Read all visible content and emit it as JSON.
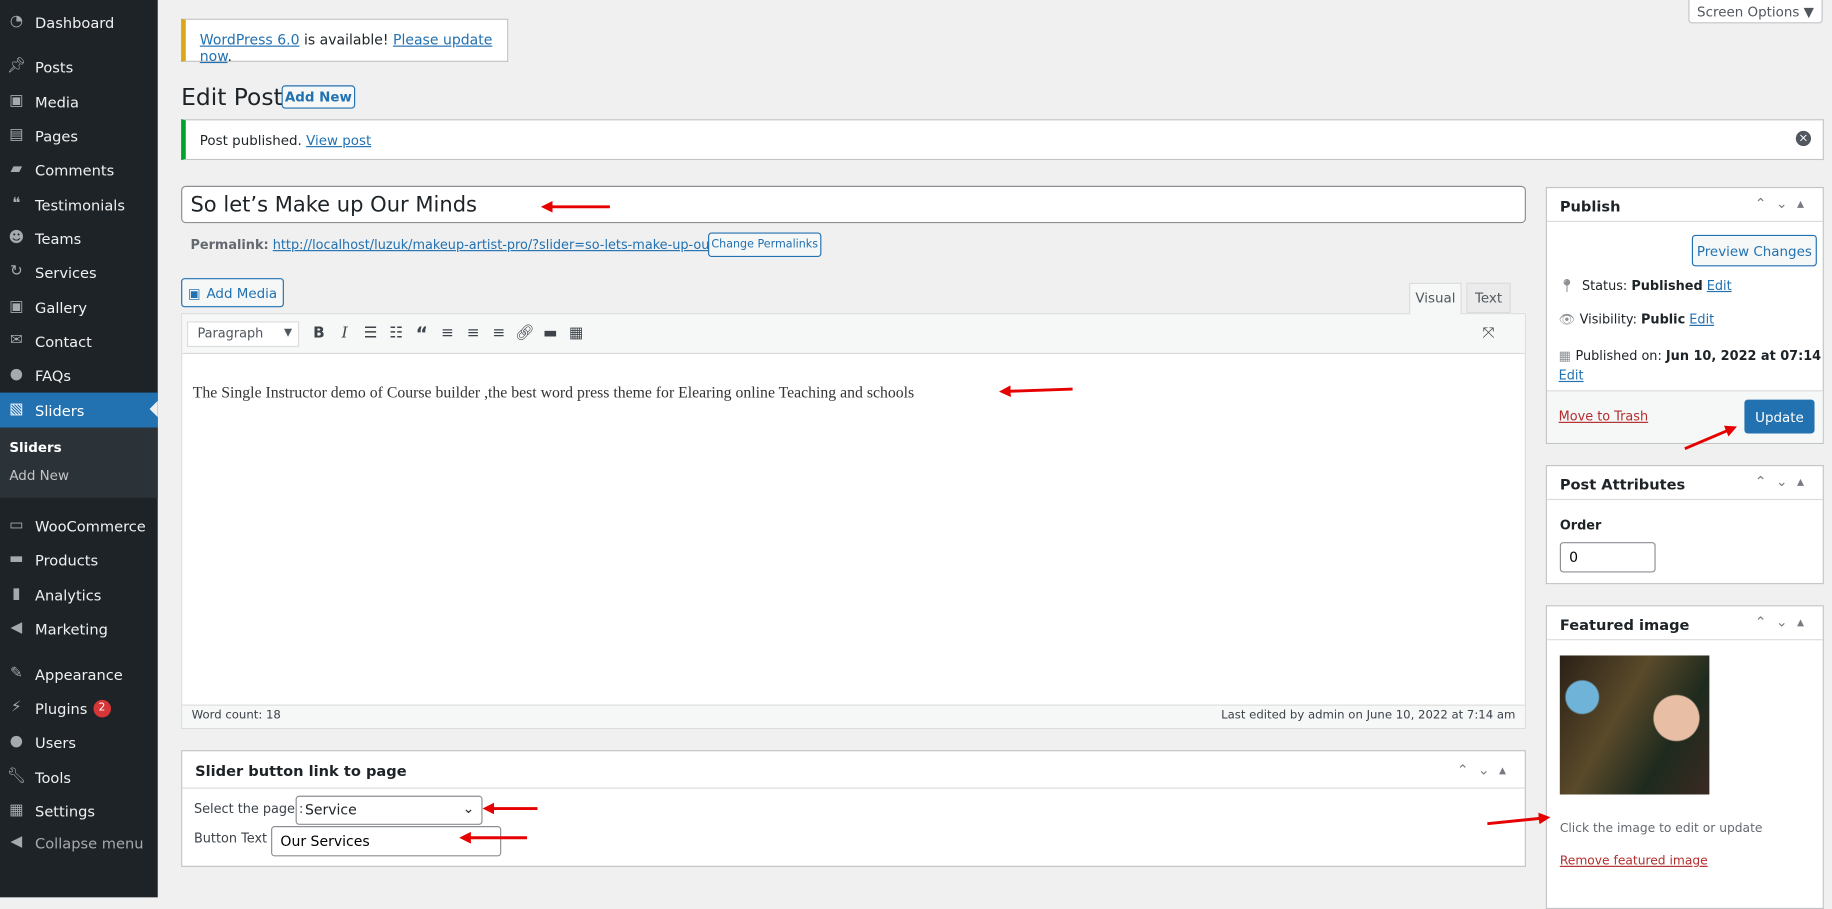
{
  "sidebar": {
    "items": [
      {
        "label": "Dashboard",
        "icon": "dashboard-icon"
      },
      {
        "label": "Posts",
        "icon": "pin-icon"
      },
      {
        "label": "Media",
        "icon": "media-icon"
      },
      {
        "label": "Pages",
        "icon": "pages-icon"
      },
      {
        "label": "Comments",
        "icon": "comment-icon"
      },
      {
        "label": "Testimonials",
        "icon": "testimonial-icon"
      },
      {
        "label": "Teams",
        "icon": "groups-icon"
      },
      {
        "label": "Services",
        "icon": "update-icon"
      },
      {
        "label": "Gallery",
        "icon": "gallery-icon"
      },
      {
        "label": "Contact",
        "icon": "email-icon"
      },
      {
        "label": "FAQs",
        "icon": "chat-icon"
      },
      {
        "label": "Sliders",
        "icon": "slides-icon",
        "active": true
      },
      {
        "label": "WooCommerce",
        "icon": "woo-icon"
      },
      {
        "label": "Products",
        "icon": "archive-icon"
      },
      {
        "label": "Analytics",
        "icon": "bar-chart-icon"
      },
      {
        "label": "Marketing",
        "icon": "megaphone-icon"
      },
      {
        "label": "Appearance",
        "icon": "brush-icon"
      },
      {
        "label": "Plugins",
        "icon": "plugin-icon",
        "badge": "2"
      },
      {
        "label": "Users",
        "icon": "user-icon"
      },
      {
        "label": "Tools",
        "icon": "wrench-icon"
      },
      {
        "label": "Settings",
        "icon": "settings-icon"
      },
      {
        "label": "Collapse menu",
        "icon": "collapse-icon"
      }
    ],
    "submenu": [
      "Sliders",
      "Add New"
    ]
  },
  "screen_options": "Screen Options ▼",
  "update_notice": {
    "link1": "WordPress 6.0",
    "mid": " is available! ",
    "link2": "Please update now",
    "end": "."
  },
  "page_title": "Edit Post",
  "add_new": "Add New",
  "success_notice": {
    "text": "Post published. ",
    "link": "View post"
  },
  "post_title": "So let’s Make up Our Minds",
  "permalink": {
    "label": "Permalink:",
    "url": "http://localhost/luzuk/makeup-artist-pro/?slider=so-lets-make-up-our-minds",
    "button": "Change Permalinks"
  },
  "add_media": "Add Media",
  "editor": {
    "tabs": [
      "Visual",
      "Text"
    ],
    "format": "Paragraph",
    "content": "The Single Instructor demo of Course builder ,the best word press theme for Elearing online Teaching and schools",
    "word_count": "Word count: 18",
    "last_edited": "Last edited by admin on June 10, 2022 at 7:14 am"
  },
  "slider_box": {
    "title": "Slider button link to page",
    "select_label": "Select the page :",
    "select_value": "Service",
    "text_label": "Button Text :",
    "text_value": "Our Services"
  },
  "publish": {
    "title": "Publish",
    "preview": "Preview Changes",
    "status_label": "Status: ",
    "status": "Published",
    "visibility_label": "Visibility: ",
    "visibility": "Public",
    "published_label": "Published on: ",
    "published": "Jun 10, 2022 at 07:14",
    "edit": "Edit",
    "trash": "Move to Trash",
    "update": "Update"
  },
  "attributes": {
    "title": "Post Attributes",
    "order_label": "Order",
    "order_value": "0"
  },
  "featured": {
    "title": "Featured image",
    "hint": "Click the image to edit or update",
    "remove": "Remove featured image"
  },
  "colors": {
    "accent": "#2271b1",
    "sidebar": "#1d2327",
    "annotation": "#e60000"
  }
}
